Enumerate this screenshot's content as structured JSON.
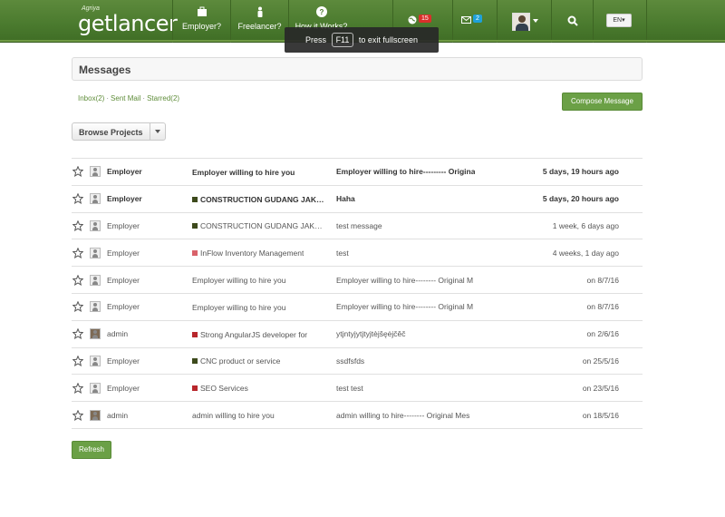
{
  "header": {
    "logo_small": "Agriya",
    "logo_text": "getlancer",
    "nav": [
      {
        "label": "Employer?",
        "icon": "briefcase-icon"
      },
      {
        "label": "Freelancer?",
        "icon": "person-icon"
      },
      {
        "label": "How it Works?",
        "icon": "question-icon"
      }
    ],
    "notifications_count": "15",
    "messages_count": "2",
    "language": "EN"
  },
  "fullscreen_notice": {
    "prefix": "Press",
    "key": "F11",
    "suffix": "to exit fullscreen"
  },
  "page": {
    "title": "Messages"
  },
  "tabs": [
    {
      "label": "Inbox(2)"
    },
    {
      "label": "Sent Mail"
    },
    {
      "label": "Starred(2)"
    }
  ],
  "compose_label": "Compose Message",
  "browse_label": "Browse Projects",
  "refresh_label": "Refresh",
  "colors": {
    "accent_green": "#6ba046",
    "header_green": "#4a7a2e"
  },
  "messages": [
    {
      "from": "Employer",
      "project": "Employer willing to hire you",
      "project_color": "",
      "subject": "Employer willing to hire--------- Original M",
      "date": "5 days, 19 hours ago",
      "unread": true,
      "avatar": "default"
    },
    {
      "from": "Employer",
      "project": "CONSTRUCTION GUDANG JAKARTA",
      "project_color": "#3d4a1c",
      "subject": "Haha",
      "date": "5 days, 20 hours ago",
      "unread": true,
      "avatar": "default"
    },
    {
      "from": "Employer",
      "project": "CONSTRUCTION GUDANG JAKARTA",
      "project_color": "#3d4a1c",
      "subject": "test message",
      "date": "1 week, 6 days ago",
      "unread": false,
      "avatar": "default"
    },
    {
      "from": "Employer",
      "project": "InFlow Inventory Management",
      "project_color": "#d9626a",
      "subject": "test",
      "date": "4 weeks, 1 day ago",
      "unread": false,
      "avatar": "default"
    },
    {
      "from": "Employer",
      "project": "Employer willing to hire you",
      "project_color": "",
      "subject": "Employer willing to hire-------- Original M",
      "date": "on 8/7/16",
      "unread": false,
      "avatar": "default"
    },
    {
      "from": "Employer",
      "project": "Employer willing to hire you",
      "project_color": "",
      "subject": "Employer willing to hire-------- Original M",
      "date": "on 8/7/16",
      "unread": false,
      "avatar": "default"
    },
    {
      "from": "admin",
      "project": "Strong AngularJS developer for",
      "project_color": "#b8262c",
      "subject": "ytjntyjytjtyjtèjšęėjčěč",
      "date": "on 2/6/16",
      "unread": false,
      "avatar": "photo"
    },
    {
      "from": "Employer",
      "project": "CNC product or service",
      "project_color": "#3d4a1c",
      "subject": "ssdfsfds",
      "date": "on 25/5/16",
      "unread": false,
      "avatar": "default"
    },
    {
      "from": "Employer",
      "project": "SEO Services",
      "project_color": "#b8262c",
      "subject": "test test",
      "date": "on 23/5/16",
      "unread": false,
      "avatar": "default"
    },
    {
      "from": "admin",
      "project": "admin willing to hire you",
      "project_color": "",
      "subject": "admin willing to hire-------- Original Mes",
      "date": "on 18/5/16",
      "unread": false,
      "avatar": "photo"
    }
  ]
}
